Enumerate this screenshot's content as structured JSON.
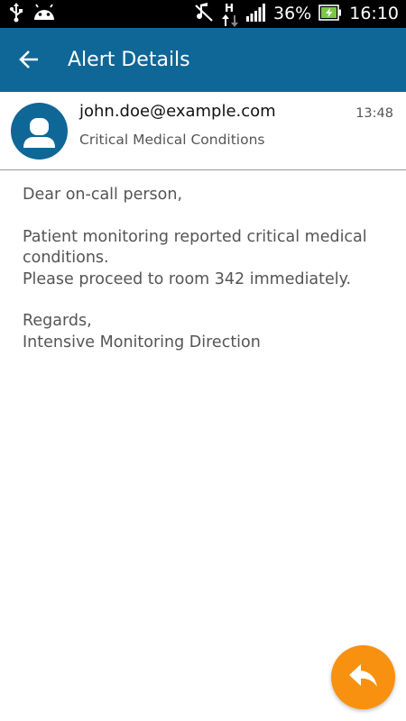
{
  "status_bar": {
    "battery_percent": "36%",
    "clock": "16:10",
    "network_letter": "H",
    "icons": [
      "usb-icon",
      "android-icon",
      "muted-icon",
      "data-arrows-icon",
      "signal-icon",
      "battery-charging-icon"
    ]
  },
  "app_bar": {
    "title": "Alert Details",
    "back_icon": "arrow-left-icon",
    "color": "#0e6797"
  },
  "alert": {
    "sender": "john.doe@example.com",
    "subject": "Critical Medical Conditions",
    "time": "13:48",
    "avatar_icon": "user-avatar-icon",
    "body": {
      "greeting": "Dear on-call person,",
      "line1": "Patient monitoring reported critical medical conditions.",
      "line2": "Please proceed to room 342 immediately.",
      "closing": "Regards,",
      "signature": "Intensive Monitoring Direction"
    }
  },
  "fab": {
    "icon": "reply-icon",
    "color": "#f7910f"
  }
}
